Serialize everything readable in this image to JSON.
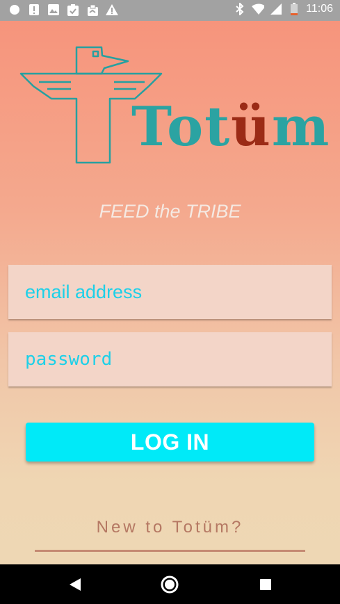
{
  "status_bar": {
    "time": "11:06",
    "left_icons": [
      "notification-circle-icon",
      "alert-icon",
      "image-icon",
      "clipboard-check-icon",
      "clipboard-icon",
      "warning-icon"
    ],
    "right_icons": [
      "bluetooth-icon",
      "wifi-icon",
      "signal-icon",
      "battery-icon"
    ]
  },
  "logo": {
    "word_start": "Tot",
    "word_umlaut": "ü",
    "word_end": "m"
  },
  "tagline": "FEED the TRIBE",
  "form": {
    "email_placeholder": "email address",
    "password_placeholder": "password",
    "login_label": "LOG IN",
    "signup_prompt": "New to Totüm?"
  },
  "nav_bar": {
    "icons": [
      "back-icon",
      "home-icon",
      "recents-icon"
    ]
  },
  "colors": {
    "accent": "#00eaf8",
    "input_text": "#1dd0e8",
    "brand_teal": "#2ba3a2",
    "brand_red": "#9b2b16"
  }
}
